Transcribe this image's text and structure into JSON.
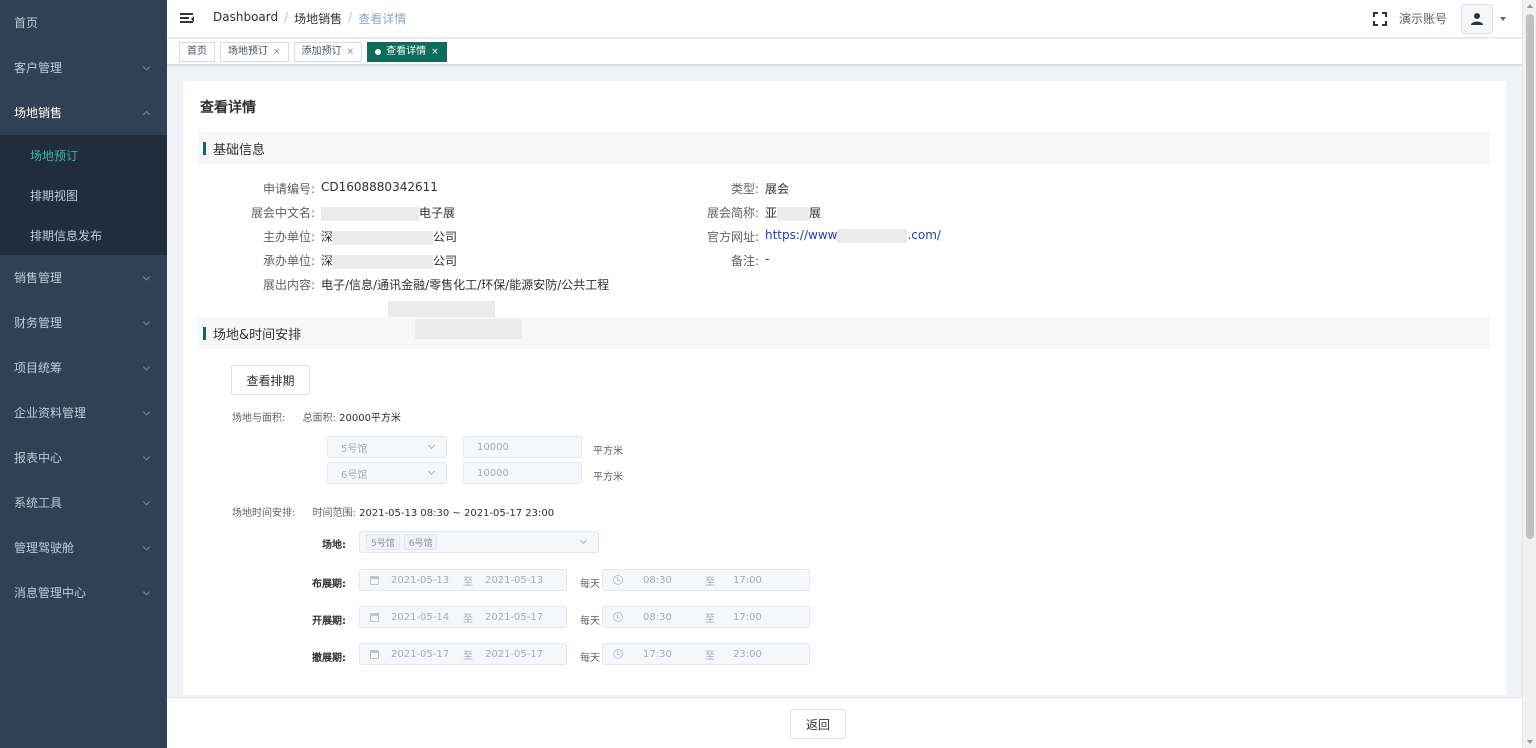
{
  "sidebar": {
    "items": [
      {
        "label": "首页",
        "has_arrow": false
      },
      {
        "label": "客户管理",
        "has_arrow": true
      },
      {
        "label": "场地销售",
        "has_arrow": true,
        "expanded": true
      },
      {
        "label": "销售管理",
        "has_arrow": true
      },
      {
        "label": "财务管理",
        "has_arrow": true
      },
      {
        "label": "项目统筹",
        "has_arrow": true
      },
      {
        "label": "企业资料管理",
        "has_arrow": true
      },
      {
        "label": "报表中心",
        "has_arrow": true
      },
      {
        "label": "系统工具",
        "has_arrow": true
      },
      {
        "label": "管理驾驶舱",
        "has_arrow": true
      },
      {
        "label": "消息管理中心",
        "has_arrow": true
      }
    ],
    "subitems": [
      {
        "label": "场地预订",
        "active": true
      },
      {
        "label": "排期视图",
        "active": false
      },
      {
        "label": "排期信息发布",
        "active": false
      }
    ]
  },
  "navbar": {
    "breadcrumb": [
      "Dashboard",
      "场地销售",
      "查看详情"
    ],
    "separator": "/",
    "account_name": "演示账号"
  },
  "tags": [
    {
      "label": "首页",
      "closable": false,
      "active": false
    },
    {
      "label": "场地预订",
      "closable": true,
      "active": false
    },
    {
      "label": "添加预订",
      "closable": true,
      "active": false
    },
    {
      "label": "查看详情",
      "closable": true,
      "active": true
    }
  ],
  "page": {
    "title": "查看详情",
    "section_basic": "基础信息",
    "section_venue": "场地&时间安排"
  },
  "basic_info": {
    "left": [
      {
        "label": "申请编号:",
        "value": "CD1608880342611"
      },
      {
        "label": "展会中文名:",
        "prefix": "",
        "suffix": "电子展"
      },
      {
        "label": "主办单位:",
        "prefix": "深",
        "suffix": "公司"
      },
      {
        "label": "承办单位:",
        "prefix": "深",
        "suffix": "公司"
      },
      {
        "label": "展出内容:",
        "value": "电子/信息/通讯金融/零售化工/环保/能源安防/公共工程"
      }
    ],
    "right": [
      {
        "label": "类型:",
        "value": "展会"
      },
      {
        "label": "展会简称:",
        "prefix": "亚",
        "suffix": "展"
      },
      {
        "label": "官方网址:",
        "prefix": "https://www",
        "suffix": ".com/"
      },
      {
        "label": "备注:",
        "value": "-"
      }
    ]
  },
  "venue": {
    "view_schedule_button": "查看排期",
    "area_label": "场地与面积:",
    "total_area_label": "总面积:",
    "total_area_value": "20000平方米",
    "halls": [
      {
        "hall": "5号馆",
        "area": "10000",
        "unit": "平方米"
      },
      {
        "hall": "6号馆",
        "area": "10000",
        "unit": "平方米"
      }
    ],
    "time_label": "场地时间安排:",
    "time_range_label": "时间范围:",
    "time_range_value": "2021-05-13 08:30 ~ 2021-05-17 23:00",
    "venue_label": "场地:",
    "venue_chips": [
      "5号馆",
      "6号馆"
    ],
    "daily_label": "每天",
    "to_label": "至",
    "periods": [
      {
        "label": "布展期:",
        "start_date": "2021-05-13",
        "end_date": "2021-05-13",
        "start_time": "08:30",
        "end_time": "17:00"
      },
      {
        "label": "开展期:",
        "start_date": "2021-05-14",
        "end_date": "2021-05-17",
        "start_time": "08:30",
        "end_time": "17:00"
      },
      {
        "label": "撤展期:",
        "start_date": "2021-05-17",
        "end_date": "2021-05-17",
        "start_time": "17:30",
        "end_time": "23:00"
      }
    ]
  },
  "footer": {
    "back_button": "返回"
  },
  "colors": {
    "sidebar_bg": "#304156",
    "accent": "#0e6b5d",
    "active_menu": "#3fb6a0",
    "link": "#1a3cc9"
  }
}
